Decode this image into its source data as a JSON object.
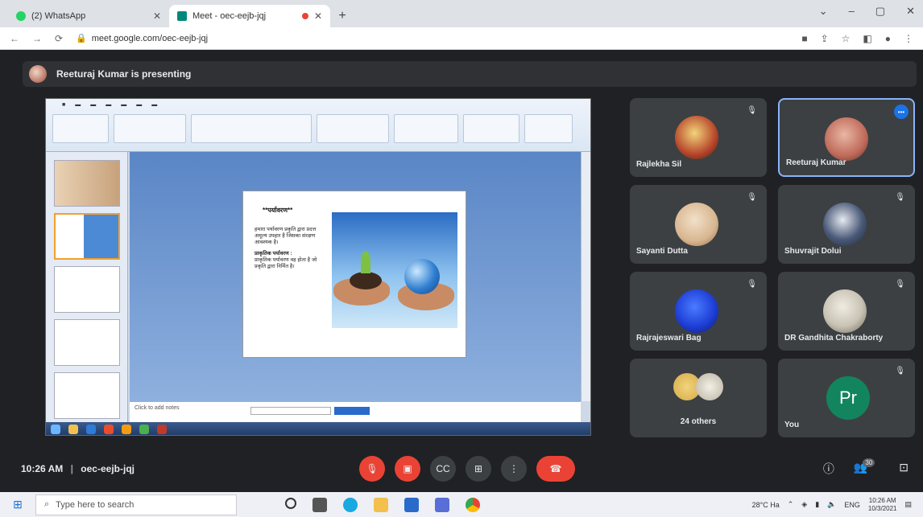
{
  "browser": {
    "tabs": [
      {
        "title": "(2) WhatsApp",
        "active": false,
        "color": "#25d366"
      },
      {
        "title": "Meet - oec-eejb-jqj",
        "active": true,
        "color": "#00897b"
      }
    ],
    "recording_tab_indicator": "#ea4335",
    "url": "meet.google.com/oec-eejb-jqj"
  },
  "meet": {
    "presenting_banner": "Reeturaj Kumar is presenting",
    "clock": "10:26 AM",
    "meeting_code": "oec-eejb-jqj",
    "participants": [
      {
        "name": "Rajlekha Sil",
        "avatar_color": "#b6462b",
        "highlighted": false
      },
      {
        "name": "Reeturaj Kumar",
        "avatar_color": "#c06a5a",
        "highlighted": true
      },
      {
        "name": "Sayanti Dutta",
        "avatar_color": "#d8b690",
        "highlighted": false
      },
      {
        "name": "Shuvrajit Dolui",
        "avatar_color": "#4a5a78",
        "highlighted": false
      },
      {
        "name": "Rajrajeswari Bag",
        "avatar_color": "#1f3fd8",
        "highlighted": false
      },
      {
        "name": "DR Gandhita Chakraborty",
        "avatar_color": "#c9c3b5",
        "highlighted": false
      },
      {
        "name": "24 others",
        "avatar_color": "#d4a94a",
        "highlighted": false
      },
      {
        "name": "You",
        "avatar_initials": "Pr",
        "avatar_color": "#12855e",
        "highlighted": false
      }
    ],
    "slide": {
      "title": "**पर्यावरण**",
      "body1": "हमारा पर्यावरण प्रकृति द्वारा प्रदत्त अमूल्य उपहार है जिसका संरक्षण आवश्यक है।",
      "subtitle": "प्राकृतिक पर्यावरण :",
      "body2": "प्राकृतिक पर्यावरण वह होता है जो प्रकृति द्वारा निर्मित है।"
    },
    "notes_placeholder": "Click to add notes"
  },
  "windows": {
    "search_placeholder": "Type here to search",
    "weather": "28°C Ha",
    "language": "ENG",
    "time": "10:26 AM",
    "date": "10/3/2021"
  }
}
